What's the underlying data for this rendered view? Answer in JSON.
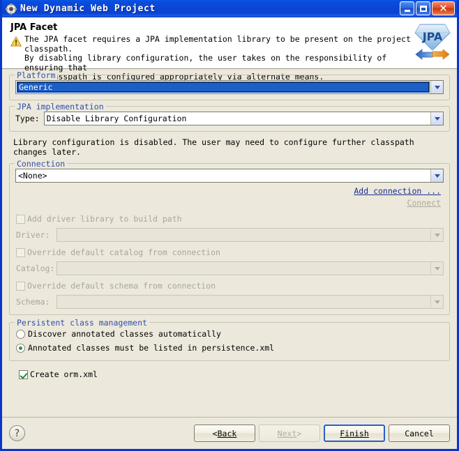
{
  "window": {
    "title": "New Dynamic Web Project",
    "icon": "app-gear-icon",
    "controls": {
      "minimize": "Minimize",
      "maximize": "Maximize",
      "close": "Close"
    },
    "frame_color": "#0a37c8"
  },
  "header": {
    "title": "JPA Facet",
    "warning_icon": "warning-triangle-icon",
    "message": "The JPA facet requires a JPA implementation library to be present on the project classpath.\nBy disabling library configuration, the user takes on the responsibility of ensuring that\nthe classpath is configured appropriately via alternate means.",
    "logo": "jpa-diamond-logo",
    "logo_text": "JPA"
  },
  "platform": {
    "group_label": "Platform",
    "combo_value": "Generic",
    "focused": true
  },
  "jpa_implementation": {
    "group_label": "JPA implementation",
    "type_label": "Type:",
    "type_value": "Disable Library Configuration"
  },
  "library_info": "Library configuration is disabled. The user may need to configure further classpath changes later.",
  "connection": {
    "group_label": "Connection",
    "combo_value": "<None>",
    "add_connection_link": "Add connection ...",
    "connect_link": "Connect",
    "add_driver_checkbox": {
      "label": "Add driver library to build path",
      "checked": false,
      "enabled": false
    },
    "driver_label": "Driver:",
    "driver_value": "",
    "override_catalog_checkbox": {
      "label": "Override default catalog from connection",
      "checked": false,
      "enabled": false
    },
    "catalog_label": "Catalog:",
    "catalog_value": "",
    "override_schema_checkbox": {
      "label": "Override default schema from connection",
      "checked": false,
      "enabled": false
    },
    "schema_label": "Schema:",
    "schema_value": ""
  },
  "persistent_class_management": {
    "group_label": "Persistent class management",
    "options": [
      {
        "label": "Discover annotated classes automatically",
        "selected": false
      },
      {
        "label": "Annotated classes must be listed in persistence.xml",
        "selected": true
      }
    ]
  },
  "create_orm": {
    "label": "Create orm.xml",
    "checked": true
  },
  "buttons": {
    "help": "?",
    "back": "Back",
    "back_prefix": "< ",
    "next": "Next",
    "next_suffix": " >",
    "finish": "Finish",
    "cancel": "Cancel"
  }
}
